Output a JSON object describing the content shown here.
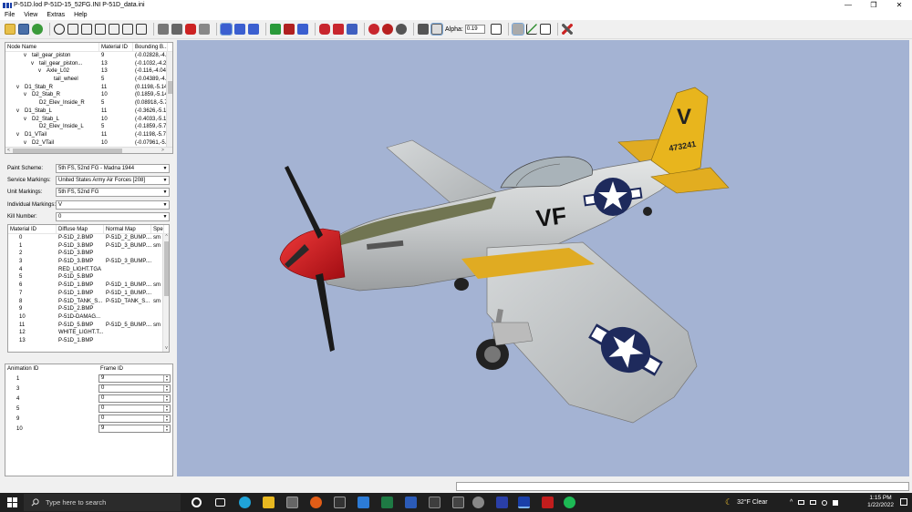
{
  "window": {
    "title": "P-51D.lod  P-51D-15_52FG.INI  P-51D_data.ini",
    "controls": [
      "—",
      "❐",
      "✕"
    ]
  },
  "menu": [
    "File",
    "View",
    "Extras",
    "Help"
  ],
  "toolbar": {
    "alpha_label": "Alpha:",
    "alpha_value": "0.19"
  },
  "node_tree": {
    "columns": [
      "Node Name",
      "Material ID",
      "Bounding B..."
    ],
    "rows": [
      {
        "indent": 2,
        "expander": "v",
        "name": "tail_gear_piston",
        "material": "9",
        "bounds": "(-0.02828,-4."
      },
      {
        "indent": 3,
        "expander": "v",
        "name": "tail_gear_piston...",
        "material": "13",
        "bounds": "(-0.1032,-4.2"
      },
      {
        "indent": 4,
        "expander": "v",
        "name": "Axle_L02",
        "material": "13",
        "bounds": "(-0.116,-4.04"
      },
      {
        "indent": 5,
        "expander": "",
        "name": "tail_wheel",
        "material": "5",
        "bounds": "(-0.04389,-4."
      },
      {
        "indent": 1,
        "expander": "v",
        "name": "D1_Stab_R",
        "material": "11",
        "bounds": "(0.1198,-5.14"
      },
      {
        "indent": 2,
        "expander": "v",
        "name": "D2_Stab_R",
        "material": "10",
        "bounds": "(0.1859,-5.14"
      },
      {
        "indent": 3,
        "expander": "",
        "name": "D2_Elev_Inside_R",
        "material": "5",
        "bounds": "(0.08918,-5.7"
      },
      {
        "indent": 1,
        "expander": "v",
        "name": "D1_Stab_L",
        "material": "11",
        "bounds": "(-0.3626,-5.1"
      },
      {
        "indent": 2,
        "expander": "v",
        "name": "D2_Stab_L",
        "material": "10",
        "bounds": "(-0.4033,-5.1"
      },
      {
        "indent": 3,
        "expander": "",
        "name": "D2_Elev_Inside_L",
        "material": "5",
        "bounds": "(-0.1859,-5.7"
      },
      {
        "indent": 1,
        "expander": "v",
        "name": "D1_VTail",
        "material": "11",
        "bounds": "(-0.1198,-5.7"
      },
      {
        "indent": 2,
        "expander": "v",
        "name": "D2_VTail",
        "material": "10",
        "bounds": "(-0.07961,-5."
      }
    ]
  },
  "settings": [
    {
      "label": "Paint Scheme:",
      "value": "5th FS, 52nd FG - Madna 1944"
    },
    {
      "label": "Service Markings:",
      "value": "United States Army Air Forces [208]"
    },
    {
      "label": "Unit Markings:",
      "value": "5th FS, 52nd FG"
    },
    {
      "label": "Individual Markings:",
      "value": "V"
    },
    {
      "label": "Kill Number:",
      "value": "0"
    }
  ],
  "materials": {
    "columns": [
      "Material ID",
      "Diffuse Map",
      "Normal Map",
      "Spe"
    ],
    "rows": [
      [
        "0",
        "P-51D_2.BMP",
        "P-51D_2_BUMP....",
        "sm"
      ],
      [
        "1",
        "P-51D_3.BMP",
        "P-51D_3_BUMP....",
        "sm"
      ],
      [
        "2",
        "P-51D_3.BMP",
        "",
        ""
      ],
      [
        "3",
        "P-51D_3.BMP",
        "P-51D_3_BUMP....",
        ""
      ],
      [
        "4",
        "RED_LIGHT.TGA",
        "",
        ""
      ],
      [
        "5",
        "P-51D_5.BMP",
        "",
        ""
      ],
      [
        "6",
        "P-51D_1.BMP",
        "P-51D_1_BUMP....",
        "sm"
      ],
      [
        "7",
        "P-51D_1.BMP",
        "P-51D_1_BUMP....",
        ""
      ],
      [
        "8",
        "P-51D_TANK_S...",
        "P-51D_TANK_S...",
        "sm"
      ],
      [
        "9",
        "P-51D_2.BMP",
        "",
        ""
      ],
      [
        "10",
        "P-51D-DAMAG...",
        "",
        ""
      ],
      [
        "11",
        "P-51D_5.BMP",
        "P-51D_5_BUMP....",
        "sm"
      ],
      [
        "12",
        "WHITE_LIGHT.T...",
        "",
        ""
      ],
      [
        "13",
        "P-51D_1.BMP",
        "",
        ""
      ]
    ]
  },
  "animations": {
    "columns": [
      "Animation ID",
      "Frame ID"
    ],
    "rows": [
      {
        "id": "1",
        "frame": "9"
      },
      {
        "id": "3",
        "frame": "0"
      },
      {
        "id": "4",
        "frame": "0"
      },
      {
        "id": "5",
        "frame": "0"
      },
      {
        "id": "9",
        "frame": "0"
      },
      {
        "id": "10",
        "frame": "9"
      }
    ]
  },
  "aircraft": {
    "code": "VF",
    "tail_letter": "V",
    "serial": "473241",
    "colors": {
      "background": "#a4b3d3",
      "tail": "#e8b51d",
      "spinner": "#d0141c",
      "fuselage": "#c9cccd",
      "olive": "#6d7050",
      "insignia_blue": "#1e2a5c"
    }
  },
  "taskbar": {
    "search_placeholder": "Type here to search",
    "weather": "32°F  Clear",
    "time": "1:15 PM",
    "date": "1/22/2022",
    "icons": [
      "task-view-icon",
      "edge-icon",
      "file-explorer-icon",
      "store-icon",
      "firefox-icon",
      "notes-icon",
      "mail-icon",
      "excel-icon",
      "word-icon",
      "photos-icon",
      "gear-icon",
      "app-icon",
      "lod-viewer-icon",
      "acrobat-icon",
      "spotify-icon"
    ]
  }
}
